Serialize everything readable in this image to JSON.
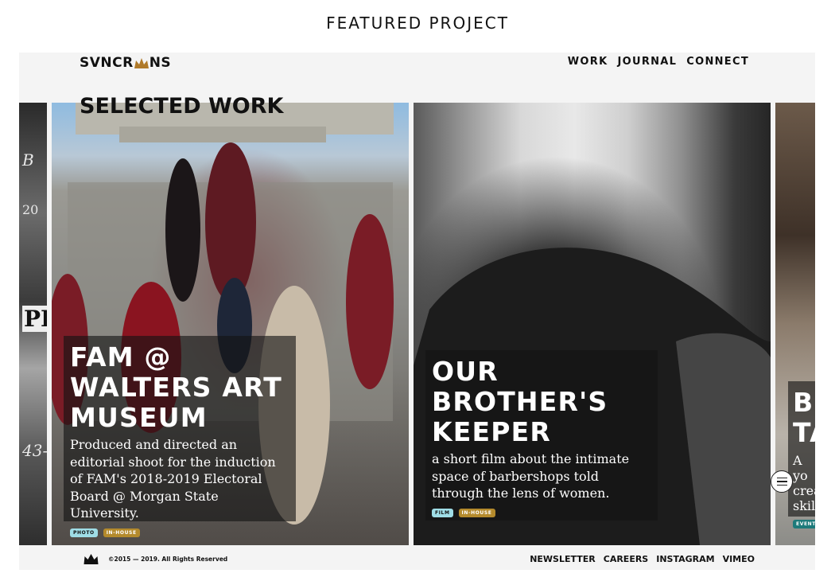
{
  "caption": "FEATURED PROJECT",
  "logo": {
    "before": "SVNCR",
    "after": "NS",
    "crown_color": "#b07a2a"
  },
  "nav": {
    "items": [
      "WORK",
      "JOURNAL",
      "CONNECT"
    ]
  },
  "section_title": "SELECTED WORK",
  "left_card": {
    "text": "B",
    "line2": "20",
    "line3": "PE",
    "line4": "43-"
  },
  "projects": [
    {
      "title_lines": [
        "FAM @",
        "WALTERS ART",
        "MUSEUM"
      ],
      "description": "Produced and directed an editorial shoot for the induction of FAM's 2018-2019 Electoral Board @ Morgan State University.",
      "tags": [
        "PHOTO",
        "IN-HOUSE"
      ]
    },
    {
      "title_lines": [
        "OUR",
        "BROTHER'S",
        "KEEPER"
      ],
      "description": "a short film about the intimate space of barbershops told through the lens of women.",
      "tags": [
        "FILM",
        "IN-HOUSE"
      ]
    }
  ],
  "right_card": {
    "title_lines": [
      "B",
      "TA"
    ],
    "desc_lines": [
      "A yo",
      "crea",
      "skil"
    ],
    "tag": "EVENT"
  },
  "footer": {
    "copyright": "©2015 — 2019. All Rights Reserved",
    "links": [
      "NEWSLETTER",
      "CAREERS",
      "INSTAGRAM",
      "VIMEO"
    ]
  },
  "colors": {
    "tag_light": "#9fdde6",
    "tag_gold": "#b48a2c",
    "tag_teal": "#1d7a7a"
  }
}
